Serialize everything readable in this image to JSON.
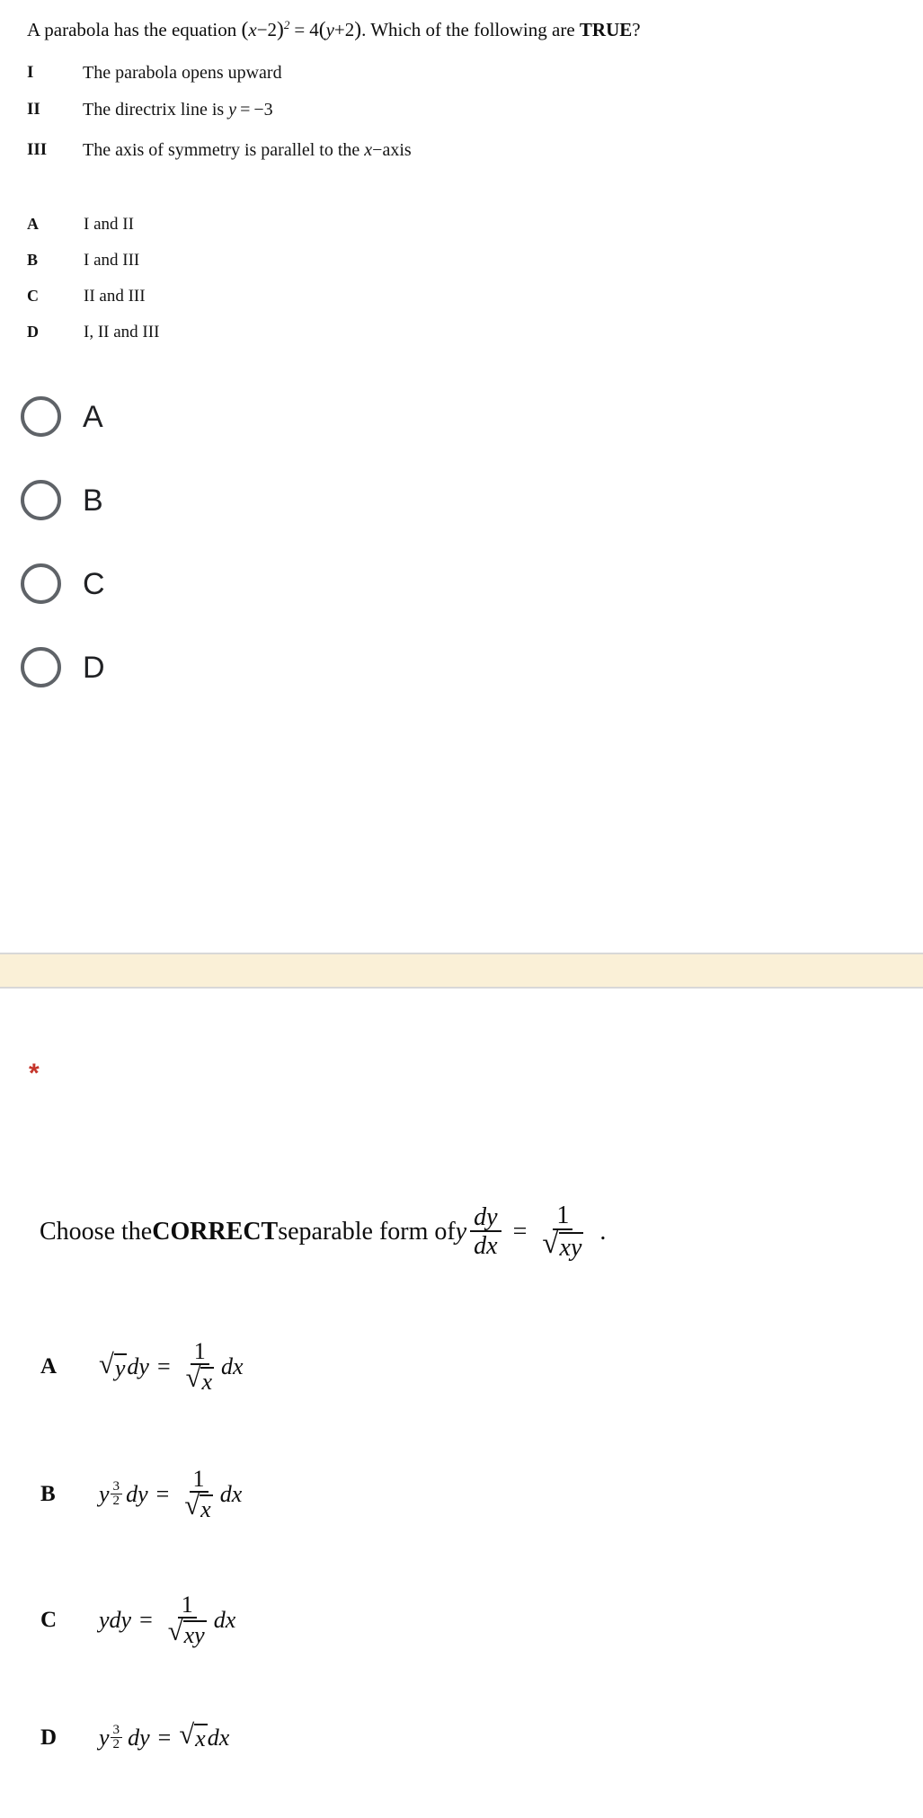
{
  "question1": {
    "stem": {
      "prefix": "A parabola has the equation ",
      "equation": {
        "lhs_open": "(",
        "lhs_var": "x",
        "lhs_minus": "−",
        "lhs_num": "2",
        "lhs_close": ")",
        "lhs_power": "2",
        "equals": "=",
        "rhs_coef": "4",
        "rhs_open": "(",
        "rhs_var": "y",
        "rhs_plus": "+",
        "rhs_num": "2",
        "rhs_close": ")",
        "plain": "(x−2)² = 4(y+2)"
      },
      "suffix_before_bold": ". Which of the following are ",
      "bold_word": "TRUE",
      "suffix_after_bold": "?"
    },
    "statements": [
      {
        "numeral": "I",
        "text": "The parabola opens upward"
      },
      {
        "numeral": "II",
        "text_before": "The directrix line is ",
        "math_var": "y",
        "math_eq": "=",
        "math_val": "−3",
        "plain": "The directrix line is y = −3"
      },
      {
        "numeral": "III",
        "text_before": "The axis of symmetry is parallel to the ",
        "math_var": "x",
        "math_dash": "−",
        "math_tail": "axis",
        "plain": "The axis of symmetry is parallel to the x−axis"
      }
    ],
    "lettered_choices": [
      {
        "letter": "A",
        "text": "I and II"
      },
      {
        "letter": "B",
        "text": "I and III"
      },
      {
        "letter": "C",
        "text": "II and III"
      },
      {
        "letter": "D",
        "text": "I, II and III"
      }
    ],
    "radio_options": [
      {
        "label": "A",
        "selected": false
      },
      {
        "label": "B",
        "selected": false
      },
      {
        "label": "C",
        "selected": false
      },
      {
        "label": "D",
        "selected": false
      }
    ]
  },
  "question2": {
    "required_marker": "*",
    "stem": {
      "text_before_bold": "Choose the ",
      "bold_word": "CORRECT",
      "text_after_bold": " separable form of ",
      "lhs_var": "y",
      "lhs_frac_num": "dy",
      "lhs_frac_den": "dx",
      "equals": "=",
      "rhs_frac_num": "1",
      "rhs_surd": "√",
      "rhs_radicand": "xy",
      "period": ".",
      "plain": "Choose the CORRECT separable form of y dy/dx = 1/√(xy) ."
    },
    "choices": [
      {
        "letter": "A",
        "lhs_surd": "√",
        "lhs_radicand": "y",
        "lhs_diff": "dy",
        "equals": "=",
        "rhs_num": "1",
        "rhs_surd": "√",
        "rhs_radicand": "x",
        "rhs_diff": "dx",
        "plain": "√y dy = (1/√x) dx"
      },
      {
        "letter": "B",
        "lhs_base": "y",
        "lhs_exp_num": "3",
        "lhs_exp_den": "2",
        "lhs_diff": "dy",
        "equals": "=",
        "rhs_num": "1",
        "rhs_surd": "√",
        "rhs_radicand": "x",
        "rhs_diff": "dx",
        "plain": "y^(3/2) dy = (1/√x) dx"
      },
      {
        "letter": "C",
        "lhs_base": "y",
        "lhs_diff": "dy",
        "equals": "=",
        "rhs_num": "1",
        "rhs_surd": "√",
        "rhs_radicand": "xy",
        "rhs_diff": "dx",
        "plain": "y dy = (1/√(xy)) dx"
      },
      {
        "letter": "D",
        "lhs_base": "y",
        "lhs_exp_num": "3",
        "lhs_exp_den": "2",
        "lhs_diff": "dy",
        "equals": "=",
        "rhs_surd": "√",
        "rhs_radicand": "x",
        "rhs_diff": "dx",
        "plain": "y^(3/2) dy = √x dx"
      }
    ]
  },
  "colors": {
    "required_star": "#c5352b",
    "radio_border": "#5f6368",
    "band_background": "#faf0d7",
    "band_border": "#d8d8d8",
    "text": "#0d0d0d"
  }
}
